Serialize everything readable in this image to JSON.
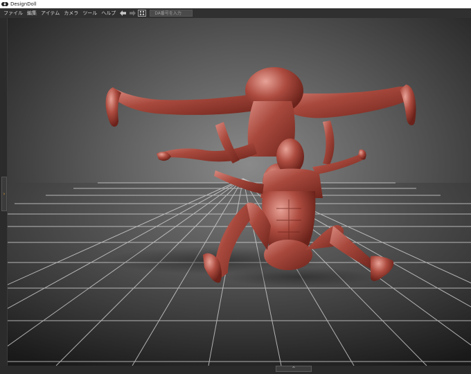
{
  "window": {
    "title": "DesignDoll"
  },
  "menu": {
    "items": [
      {
        "label": "ファイル"
      },
      {
        "label": "編集"
      },
      {
        "label": "アイテム"
      },
      {
        "label": "カメラ"
      },
      {
        "label": "ツール"
      },
      {
        "label": "ヘルプ"
      }
    ]
  },
  "toolbar": {
    "icons": [
      "back-arrow-icon",
      "forward-arrow-icon",
      "dual-figure-icon"
    ],
    "da_placeholder": "DA番号を入力",
    "da_value": ""
  },
  "panels": {
    "left_toggle_glyph": "›",
    "bottom_toggle_glyph": "^"
  },
  "colors": {
    "viewport_center": "#7e7e7e",
    "viewport_edge": "#1e1e1e",
    "grid_line": "#d6d6d6",
    "figure_skin": "#a84a3e",
    "accent_orange": "#e0a030"
  }
}
